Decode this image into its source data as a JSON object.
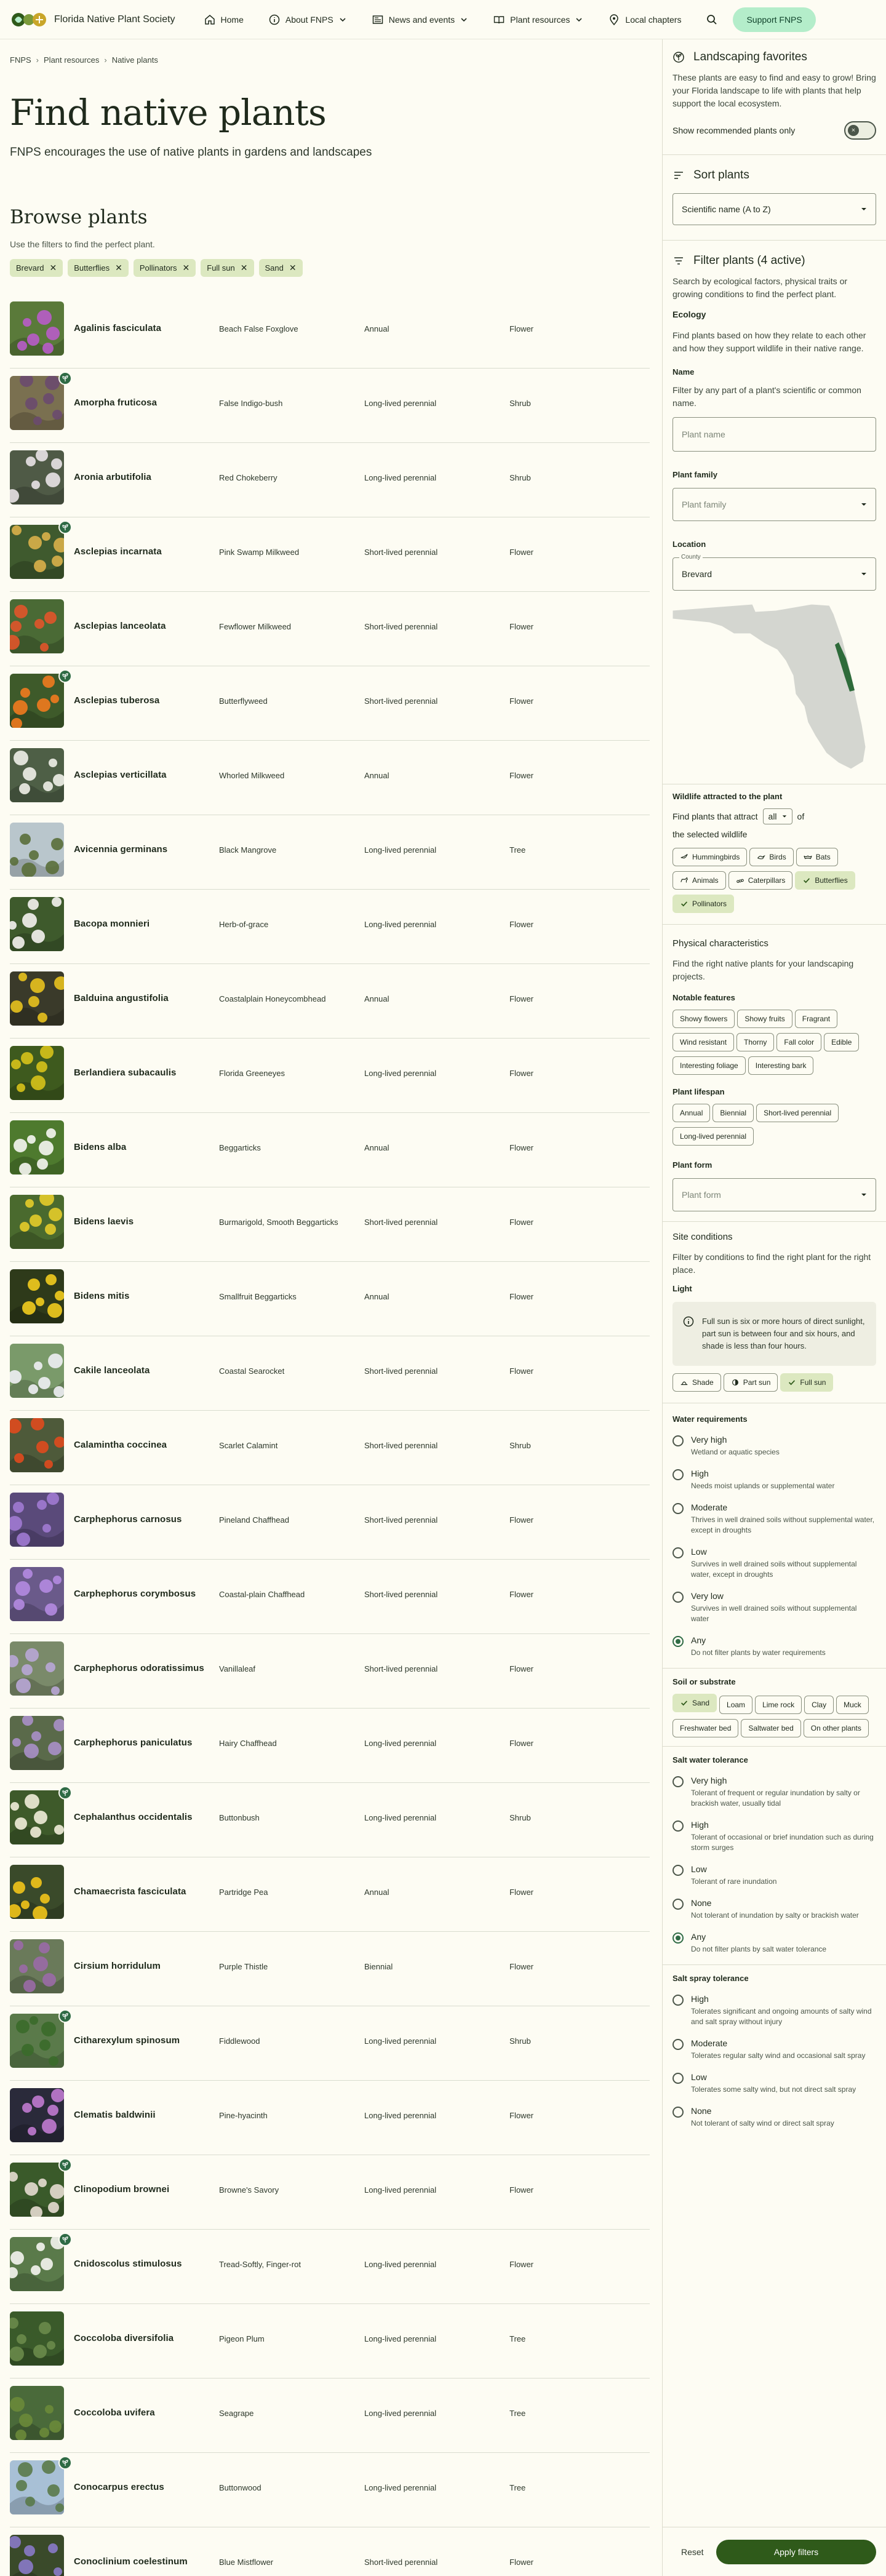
{
  "header": {
    "logo_text": "Florida Native Plant Society",
    "nav": [
      {
        "label": "Home",
        "icon": "home-icon"
      },
      {
        "label": "About FNPS",
        "icon": "info-icon"
      },
      {
        "label": "News and events",
        "icon": "newspaper-icon"
      },
      {
        "label": "Plant resources",
        "icon": "book-icon"
      },
      {
        "label": "Local chapters",
        "icon": "location-pin-icon"
      }
    ],
    "support_label": "Support FNPS"
  },
  "breadcrumb": [
    "FNPS",
    "Plant resources",
    "Native plants"
  ],
  "page": {
    "title": "Find native plants",
    "subtitle": "FNPS encourages the use of native plants in gardens and landscapes"
  },
  "browse": {
    "heading": "Browse plants",
    "hint": "Use the filters to find the perfect plant.",
    "active_filters": [
      "Brevard",
      "Butterflies",
      "Pollinators",
      "Full sun",
      "Sand"
    ]
  },
  "plants": [
    {
      "sci": "Agalinis fasciculata",
      "common": "Beach False Foxglove",
      "life": "Annual",
      "form": "Flower",
      "fav": false,
      "c": [
        "#5a7a3a",
        "#b85cc9"
      ]
    },
    {
      "sci": "Amorpha fruticosa",
      "common": "False Indigo-bush",
      "life": "Long-lived perennial",
      "form": "Shrub",
      "fav": true,
      "c": [
        "#7a7050",
        "#6a4a6e"
      ]
    },
    {
      "sci": "Aronia arbutifolia",
      "common": "Red Chokeberry",
      "life": "Long-lived perennial",
      "form": "Shrub",
      "fav": false,
      "c": [
        "#4f5a46",
        "#e8e2e6"
      ]
    },
    {
      "sci": "Asclepias incarnata",
      "common": "Pink Swamp Milkweed",
      "life": "Short-lived perennial",
      "form": "Flower",
      "fav": true,
      "c": [
        "#3f5a2e",
        "#d9b04a"
      ]
    },
    {
      "sci": "Asclepias lanceolata",
      "common": "Fewflower Milkweed",
      "life": "Short-lived perennial",
      "form": "Flower",
      "fav": false,
      "c": [
        "#4a6a35",
        "#e0552a"
      ]
    },
    {
      "sci": "Asclepias tuberosa",
      "common": "Butterflyweed",
      "life": "Short-lived perennial",
      "form": "Flower",
      "fav": true,
      "c": [
        "#3e5a2a",
        "#f07a1e"
      ]
    },
    {
      "sci": "Asclepias verticillata",
      "common": "Whorled Milkweed",
      "life": "Annual",
      "form": "Flower",
      "fav": false,
      "c": [
        "#4e5f46",
        "#f0f0e8"
      ]
    },
    {
      "sci": "Avicennia germinans",
      "common": "Black Mangrove",
      "life": "Long-lived perennial",
      "form": "Tree",
      "fav": false,
      "c": [
        "#b9c6cc",
        "#5a6e3a"
      ]
    },
    {
      "sci": "Bacopa monnieri",
      "common": "Herb-of-grace",
      "life": "Long-lived perennial",
      "form": "Flower",
      "fav": false,
      "c": [
        "#3e5a2c",
        "#f4f2f0"
      ]
    },
    {
      "sci": "Balduina angustifolia",
      "common": "Coastalplain Honeycombhead",
      "life": "Annual",
      "form": "Flower",
      "fav": false,
      "c": [
        "#3a3a2a",
        "#e8c21e"
      ]
    },
    {
      "sci": "Berlandiera subacaulis",
      "common": "Florida Greeneyes",
      "life": "Long-lived perennial",
      "form": "Flower",
      "fav": false,
      "c": [
        "#3e5a1e",
        "#d6c21a"
      ]
    },
    {
      "sci": "Bidens alba",
      "common": "Beggarticks",
      "life": "Annual",
      "form": "Flower",
      "fav": false,
      "c": [
        "#4e7a2e",
        "#f6f6f2"
      ]
    },
    {
      "sci": "Bidens laevis",
      "common": "Burmarigold, Smooth Beggarticks",
      "life": "Short-lived perennial",
      "form": "Flower",
      "fav": false,
      "c": [
        "#4a6a2e",
        "#e4cc2a"
      ]
    },
    {
      "sci": "Bidens mitis",
      "common": "Smallfruit Beggarticks",
      "life": "Annual",
      "form": "Flower",
      "fav": false,
      "c": [
        "#2e3a1a",
        "#f2cc1e"
      ]
    },
    {
      "sci": "Cakile lanceolata",
      "common": "Coastal Searocket",
      "life": "Short-lived perennial",
      "form": "Flower",
      "fav": false,
      "c": [
        "#7a9a6a",
        "#eef0f4"
      ]
    },
    {
      "sci": "Calamintha coccinea",
      "common": "Scarlet Calamint",
      "life": "Short-lived perennial",
      "form": "Shrub",
      "fav": false,
      "c": [
        "#4e5a3a",
        "#e04a1e"
      ]
    },
    {
      "sci": "Carphephorus carnosus",
      "common": "Pineland Chaffhead",
      "life": "Short-lived perennial",
      "form": "Flower",
      "fav": false,
      "c": [
        "#5a4a7a",
        "#a07ad2"
      ]
    },
    {
      "sci": "Carphephorus corymbosus",
      "common": "Coastal-plain Chaffhead",
      "life": "Short-lived perennial",
      "form": "Flower",
      "fav": false,
      "c": [
        "#6a5a8a",
        "#b48ae0"
      ]
    },
    {
      "sci": "Carphephorus odoratissimus",
      "common": "Vanillaleaf",
      "life": "Short-lived perennial",
      "form": "Flower",
      "fav": false,
      "c": [
        "#7a8a6a",
        "#b8a6d6"
      ]
    },
    {
      "sci": "Carphephorus paniculatus",
      "common": "Hairy Chaffhead",
      "life": "Long-lived perennial",
      "form": "Flower",
      "fav": false,
      "c": [
        "#5a6a4a",
        "#a890c8"
      ]
    },
    {
      "sci": "Cephalanthus occidentalis",
      "common": "Buttonbush",
      "life": "Long-lived perennial",
      "form": "Shrub",
      "fav": true,
      "c": [
        "#3e5a2a",
        "#f0ecd8"
      ]
    },
    {
      "sci": "Chamaecrista fasciculata",
      "common": "Partridge Pea",
      "life": "Annual",
      "form": "Flower",
      "fav": false,
      "c": [
        "#3a4a2a",
        "#f2c41a"
      ]
    },
    {
      "sci": "Cirsium horridulum",
      "common": "Purple Thistle",
      "life": "Biennial",
      "form": "Flower",
      "fav": false,
      "c": [
        "#6a7a5a",
        "#9a6aa6"
      ]
    },
    {
      "sci": "Citharexylum spinosum",
      "common": "Fiddlewood",
      "life": "Long-lived perennial",
      "form": "Shrub",
      "fav": true,
      "c": [
        "#5a7a4a",
        "#3a6a2a"
      ]
    },
    {
      "sci": "Clematis baldwinii",
      "common": "Pine-hyacinth",
      "life": "Long-lived perennial",
      "form": "Flower",
      "fav": false,
      "c": [
        "#2a2a3a",
        "#c07ad0"
      ]
    },
    {
      "sci": "Clinopodium brownei",
      "common": "Browne's Savory",
      "life": "Long-lived perennial",
      "form": "Flower",
      "fav": true,
      "c": [
        "#3a5a2a",
        "#e6dcd0"
      ]
    },
    {
      "sci": "Cnidoscolus stimulosus",
      "common": "Tread-Softly, Finger-rot",
      "life": "Long-lived perennial",
      "form": "Flower",
      "fav": true,
      "c": [
        "#5a7a4a",
        "#f4f4f0"
      ]
    },
    {
      "sci": "Coccoloba diversifolia",
      "common": "Pigeon Plum",
      "life": "Long-lived perennial",
      "form": "Tree",
      "fav": false,
      "c": [
        "#3a5a2a",
        "#6a8a4a"
      ]
    },
    {
      "sci": "Coccoloba uvifera",
      "common": "Seagrape",
      "life": "Long-lived perennial",
      "form": "Tree",
      "fav": false,
      "c": [
        "#4a6a3a",
        "#6a8a3a"
      ]
    },
    {
      "sci": "Conocarpus erectus",
      "common": "Buttonwood",
      "life": "Long-lived perennial",
      "form": "Tree",
      "fav": true,
      "c": [
        "#a8c0d6",
        "#5a7a4a"
      ]
    },
    {
      "sci": "Conoclinium coelestinum",
      "common": "Blue Mistflower",
      "life": "Short-lived perennial",
      "form": "Flower",
      "fav": false,
      "c": [
        "#3a4a2a",
        "#8a7ac8"
      ]
    }
  ],
  "sidebar": {
    "landscaping": {
      "title": "Landscaping favorites",
      "text": "These plants are easy to find and easy to grow! Bring your Florida landscape to life with plants that help support the local ecosystem.",
      "toggle_label": "Show recommended plants only"
    },
    "sort": {
      "title": "Sort plants",
      "value": "Scientific name (A to Z)"
    },
    "filter": {
      "title": "Filter plants (4 active)",
      "intro": "Search by ecological factors, physical traits or growing conditions to find the perfect plant.",
      "ecology_heading": "Ecology",
      "ecology_text": "Find plants based on how they relate to each other and how they support wildlife in their native range.",
      "name_label": "Name",
      "name_hint": "Filter by any part of a plant's scientific or common name.",
      "name_placeholder": "Plant name",
      "family_label": "Plant family",
      "family_placeholder": "Plant family",
      "location_label": "Location",
      "county_label": "County",
      "county_value": "Brevard",
      "wildlife_label": "Wildlife attracted to the plant",
      "wildlife_pre": "Find plants that attract",
      "wildlife_select": "all",
      "wildlife_post": "of",
      "wildlife_post2": "the selected wildlife",
      "wildlife_chips": [
        {
          "label": "Hummingbirds",
          "on": false,
          "icon": "hummingbird-icon"
        },
        {
          "label": "Birds",
          "on": false,
          "icon": "bird-icon"
        },
        {
          "label": "Bats",
          "on": false,
          "icon": "bat-icon"
        },
        {
          "label": "Animals",
          "on": false,
          "icon": "animal-icon"
        },
        {
          "label": "Caterpillars",
          "on": false,
          "icon": "caterpillar-icon"
        },
        {
          "label": "Butterflies",
          "on": true,
          "icon": "check-icon"
        },
        {
          "label": "Pollinators",
          "on": true,
          "icon": "check-icon"
        }
      ],
      "physical_heading": "Physical characteristics",
      "physical_text": "Find the right native plants for your landscaping projects.",
      "features_label": "Notable features",
      "features": [
        "Showy flowers",
        "Showy fruits",
        "Fragrant",
        "Wind resistant",
        "Thorny",
        "Fall color",
        "Edible",
        "Interesting foliage",
        "Interesting bark"
      ],
      "lifespan_label": "Plant lifespan",
      "lifespans": [
        "Annual",
        "Biennial",
        "Short-lived perennial",
        "Long-lived perennial"
      ],
      "form_label": "Plant form",
      "form_placeholder": "Plant form",
      "site_heading": "Site conditions",
      "site_text": "Filter by conditions to find the right plant for the right place.",
      "light_label": "Light",
      "light_info": "Full sun is six or more hours of direct sunlight, part sun is between four and six hours, and shade is less than four hours.",
      "light_chips": [
        {
          "label": "Shade",
          "on": false,
          "icon": "shade-icon"
        },
        {
          "label": "Part sun",
          "on": false,
          "icon": "part-sun-icon"
        },
        {
          "label": "Full sun",
          "on": true,
          "icon": "check-icon"
        }
      ],
      "water_label": "Water requirements",
      "water_options": [
        {
          "label": "Very high",
          "desc": "Wetland or aquatic species",
          "on": false
        },
        {
          "label": "High",
          "desc": "Needs moist uplands or supplemental water",
          "on": false
        },
        {
          "label": "Moderate",
          "desc": "Thrives in well drained soils without supplemental water, except in droughts",
          "on": false
        },
        {
          "label": "Low",
          "desc": "Survives in well drained soils without supplemental water, except in droughts",
          "on": false
        },
        {
          "label": "Very low",
          "desc": "Survives in well drained soils without supplemental water",
          "on": false
        },
        {
          "label": "Any",
          "desc": "Do not filter plants by water requirements",
          "on": true
        }
      ],
      "soil_label": "Soil or substrate",
      "soil_chips": [
        {
          "label": "Sand",
          "on": true
        },
        {
          "label": "Loam",
          "on": false
        },
        {
          "label": "Lime rock",
          "on": false
        },
        {
          "label": "Clay",
          "on": false
        },
        {
          "label": "Muck",
          "on": false
        },
        {
          "label": "Freshwater bed",
          "on": false
        },
        {
          "label": "Saltwater bed",
          "on": false
        },
        {
          "label": "On other plants",
          "on": false
        }
      ],
      "salt_water_label": "Salt water tolerance",
      "salt_water_options": [
        {
          "label": "Very high",
          "desc": "Tolerant of frequent or regular inundation by salty or brackish water, usually tidal",
          "on": false
        },
        {
          "label": "High",
          "desc": "Tolerant of occasional or brief inundation such as during storm surges",
          "on": false
        },
        {
          "label": "Low",
          "desc": "Tolerant of rare inundation",
          "on": false
        },
        {
          "label": "None",
          "desc": "Not tolerant of inundation by salty or brackish water",
          "on": false
        },
        {
          "label": "Any",
          "desc": "Do not filter plants by salt water tolerance",
          "on": true
        }
      ],
      "salt_spray_label": "Salt spray tolerance",
      "salt_spray_options": [
        {
          "label": "High",
          "desc": "Tolerates significant and ongoing amounts of salty wind and salt spray without injury",
          "on": false
        },
        {
          "label": "Moderate",
          "desc": "Tolerates regular salty wind and occasional salt spray",
          "on": false
        },
        {
          "label": "Low",
          "desc": "Tolerates some salty wind, but not direct salt spray",
          "on": false
        },
        {
          "label": "None",
          "desc": "Not tolerant of salty wind or direct salt spray",
          "on": false
        }
      ]
    },
    "reset_label": "Reset",
    "apply_label": "Apply filters"
  },
  "colors": {
    "accent": "#2f5a1a",
    "chip_active": "#dce8c0",
    "support": "#b4edca",
    "map_highlight": "#2e6b3a",
    "map_land": "#d4d6d0"
  }
}
